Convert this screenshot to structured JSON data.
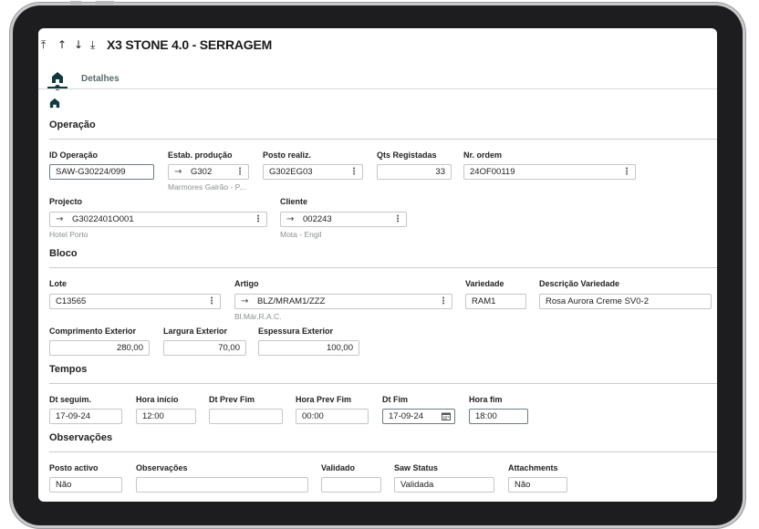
{
  "app": {
    "title": "X3 STONE 4.0 - SERRAGEM"
  },
  "nav_icons": [
    "first-record-icon",
    "previous-record-icon",
    "next-record-icon",
    "last-record-icon"
  ],
  "tabs": [
    {
      "name": "home",
      "icon": "home-icon",
      "active": true
    },
    {
      "name": "detalhes",
      "label": "Detalhes"
    }
  ],
  "sections": {
    "operacao": {
      "title": "Operação",
      "id_operacao": {
        "label": "ID Operação",
        "value": "SAW-G30224/099"
      },
      "estab_producao": {
        "label": "Estab. produção",
        "value": "G302",
        "sub": "Marmores Galrão - P..."
      },
      "posto_realiz": {
        "label": "Posto realiz.",
        "value": "G302EG03"
      },
      "qts_registadas": {
        "label": "Qts Registadas",
        "value": "33"
      },
      "nr_ordem": {
        "label": "Nr. ordem",
        "value": "24OF00119"
      },
      "projecto": {
        "label": "Projecto",
        "value": "G3022401O001",
        "sub": "Hotel Porto"
      },
      "cliente": {
        "label": "Cliente",
        "value": "002243",
        "sub": "Mota - Engil"
      }
    },
    "bloco": {
      "title": "Bloco",
      "lote": {
        "label": "Lote",
        "value": "C13565"
      },
      "artigo": {
        "label": "Artigo",
        "value": "BLZ/MRAM1/ZZZ",
        "sub": "Bl.Már.R.A.C."
      },
      "variedade": {
        "label": "Variedade",
        "value": "RAM1"
      },
      "descricao_variedade": {
        "label": "Descrição Variedade",
        "value": "Rosa Aurora Creme SV0-2"
      },
      "comprimento_exterior": {
        "label": "Comprimento Exterior",
        "value": "280,00"
      },
      "largura_exterior": {
        "label": "Largura Exterior",
        "value": "70,00"
      },
      "espessura_exterior": {
        "label": "Espessura Exterior",
        "value": "100,00"
      }
    },
    "tempos": {
      "title": "Tempos",
      "dt_seguim": {
        "label": "Dt seguim.",
        "value": "17-09-24"
      },
      "hora_inicio": {
        "label": "Hora início",
        "value": "12:00"
      },
      "dt_prev_fim": {
        "label": "Dt Prev Fim",
        "value": ""
      },
      "hora_prev_fim": {
        "label": "Hora Prev Fim",
        "value": "00:00"
      },
      "dt_fim": {
        "label": "Dt Fim",
        "value": "17-09-24"
      },
      "hora_fim": {
        "label": "Hora fim",
        "value": "18:00"
      }
    },
    "observacoes": {
      "title": "Observações",
      "posto_activo": {
        "label": "Posto activo",
        "value": "Não"
      },
      "observacoes": {
        "label": "Observações",
        "value": ""
      },
      "validado": {
        "label": "Validado",
        "value": ""
      },
      "saw_status": {
        "label": "Saw Status",
        "value": "Validada"
      },
      "attachments": {
        "label": "Attachments",
        "value": "Não"
      }
    }
  },
  "colors": {
    "accent": "#0f3b3e",
    "frame": "#1d1d1f",
    "field_border": "#c3c7c9"
  }
}
